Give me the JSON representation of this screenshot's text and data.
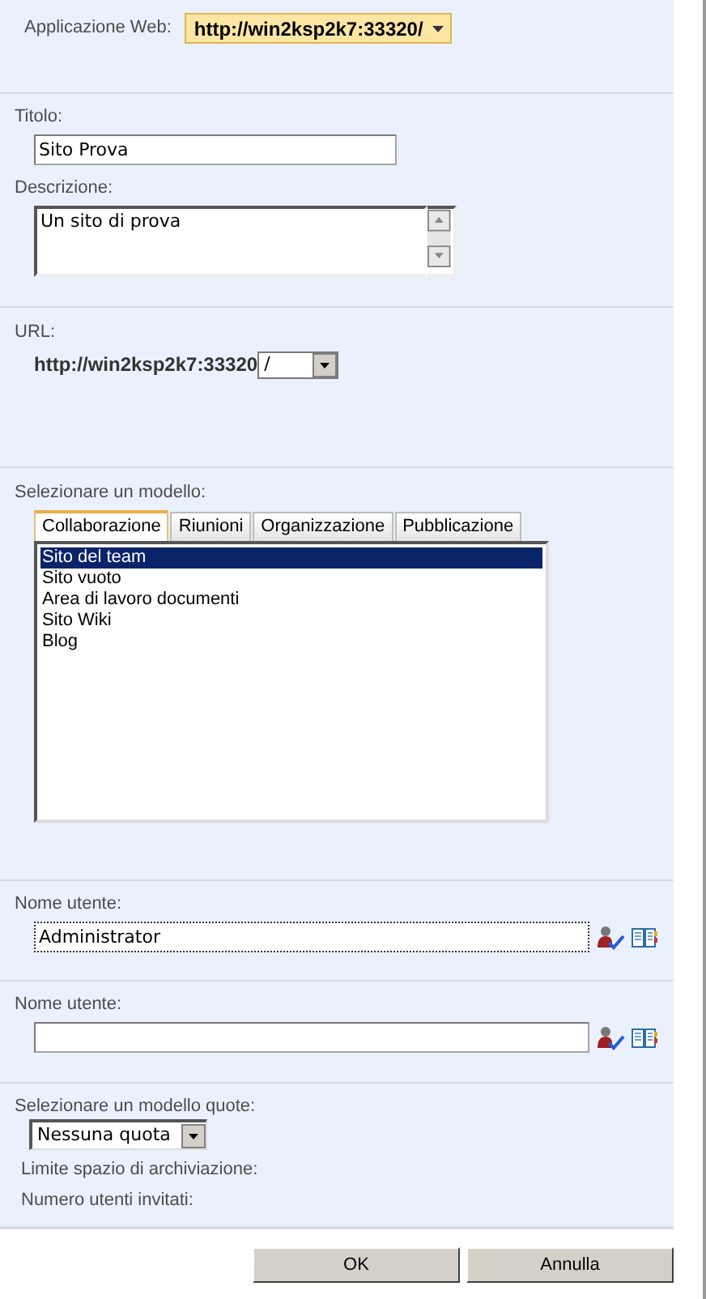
{
  "web_application": {
    "label": "Applicazione Web:",
    "value": "http://win2ksp2k7:33320/"
  },
  "title": {
    "label": "Titolo:",
    "value": "Sito Prova"
  },
  "description": {
    "label": "Descrizione:",
    "value": "Un sito di prova"
  },
  "url": {
    "label": "URL:",
    "prefix": "http://win2ksp2k7:33320",
    "value": "/"
  },
  "template": {
    "label": "Selezionare un modello:",
    "tabs": [
      {
        "label": "Collaborazione",
        "selected": true
      },
      {
        "label": "Riunioni",
        "selected": false
      },
      {
        "label": "Organizzazione",
        "selected": false
      },
      {
        "label": "Pubblicazione",
        "selected": false
      }
    ],
    "items": [
      {
        "label": "Sito del team",
        "selected": true
      },
      {
        "label": "Sito vuoto",
        "selected": false
      },
      {
        "label": "Area di lavoro documenti",
        "selected": false
      },
      {
        "label": "Sito Wiki",
        "selected": false
      },
      {
        "label": "Blog",
        "selected": false
      }
    ]
  },
  "users": [
    {
      "label": "Nome utente:",
      "value": "Administrator",
      "focused": true
    },
    {
      "label": "Nome utente:",
      "focused": false
    }
  ],
  "quota": {
    "label": "Selezionare un modello quote:",
    "value": "Nessuna quota",
    "details": [
      "Limite spazio di archiviazione:",
      "Numero utenti invitati:"
    ]
  },
  "buttons": [
    "OK",
    "Annulla"
  ]
}
